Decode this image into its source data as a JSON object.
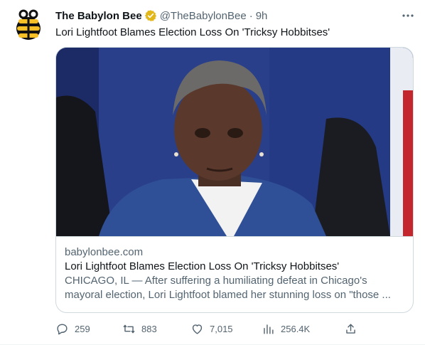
{
  "tweet": {
    "author_name": "The Babylon Bee",
    "handle": "@TheBabylonBee",
    "separator": "·",
    "time": "9h",
    "more_label": "•••",
    "text": "Lori Lightfoot Blames Election Loss On 'Tricksy Hobbitses'"
  },
  "card": {
    "domain": "babylonbee.com",
    "title": "Lori Lightfoot Blames Election Loss On 'Tricksy Hobbitses'",
    "description": "CHICAGO, IL — After suffering a humiliating defeat in Chicago's mayoral election, Lori Lightfoot blamed her stunning loss on \"those ..."
  },
  "actions": {
    "replies": "259",
    "retweets": "883",
    "likes": "7,015",
    "views": "256.4K"
  },
  "colors": {
    "text_primary": "#0f1419",
    "text_secondary": "#536471",
    "border": "#cfd9de",
    "verified_gold": "#e2b719",
    "logo_yellow": "#f6c026"
  }
}
